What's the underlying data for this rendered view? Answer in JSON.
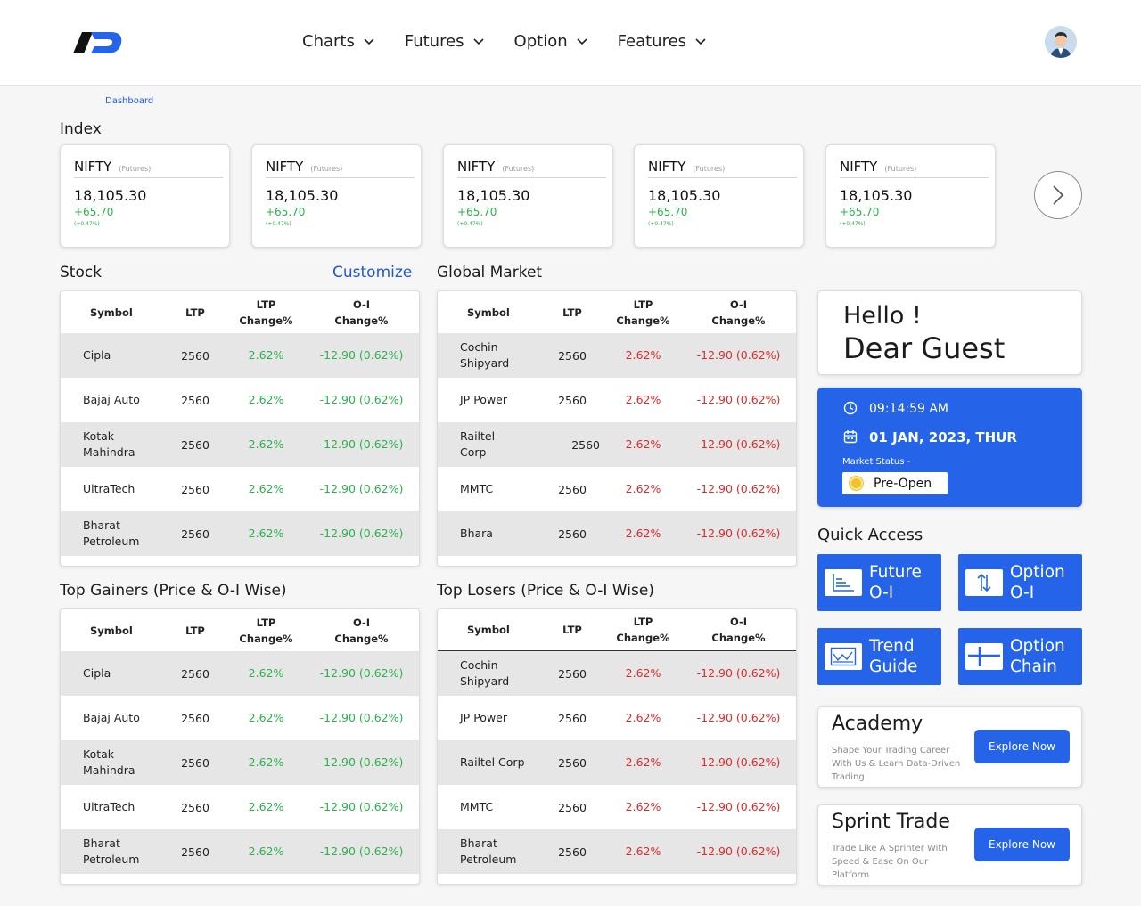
{
  "header": {
    "nav": [
      "Charts",
      "Futures",
      "Option",
      "Features"
    ]
  },
  "breadcrumb": "Dashboard",
  "index": {
    "title": "Index",
    "cards": [
      {
        "name": "NIFTY",
        "tag": "(Futures)",
        "value": "18,105.30",
        "change": "+65.70",
        "pct": "(+0.47%)"
      },
      {
        "name": "NIFTY",
        "tag": "(Futures)",
        "value": "18,105.30",
        "change": "+65.70",
        "pct": "(+0.47%)"
      },
      {
        "name": "NIFTY",
        "tag": "(Futures)",
        "value": "18,105.30",
        "change": "+65.70",
        "pct": "(+0.47%)"
      },
      {
        "name": "NIFTY",
        "tag": "(Futures)",
        "value": "18,105.30",
        "change": "+65.70",
        "pct": "(+0.47%)"
      },
      {
        "name": "NIFTY",
        "tag": "(Futures)",
        "value": "18,105.30",
        "change": "+65.70",
        "pct": "(+0.47%)"
      }
    ]
  },
  "stock": {
    "title": "Stock",
    "customize": "Customize",
    "headers": [
      "Symbol",
      "LTP",
      "LTP\nChange%",
      "O-I\nChange%"
    ],
    "rows": [
      {
        "symbol": "Cipla",
        "ltp": "2560",
        "chg": "2.62%",
        "oi": "-12.90 (0.62%)"
      },
      {
        "symbol": "Bajaj Auto",
        "ltp": "2560",
        "chg": "2.62%",
        "oi": "-12.90 (0.62%)"
      },
      {
        "symbol": "Kotak\nMahindra",
        "ltp": "2560",
        "chg": "2.62%",
        "oi": "-12.90 (0.62%)"
      },
      {
        "symbol": "UltraTech",
        "ltp": "2560",
        "chg": "2.62%",
        "oi": "-12.90 (0.62%)"
      },
      {
        "symbol": "Bharat\nPetroleum",
        "ltp": "2560",
        "chg": "2.62%",
        "oi": "-12.90 (0.62%)"
      }
    ]
  },
  "global": {
    "title": "Global Market",
    "headers": [
      "Symbol",
      "LTP",
      "LTP\nChange%",
      "O-I\nChange%"
    ],
    "rows": [
      {
        "symbol": "Cochin\nShipyard",
        "ltp": "2560",
        "chg": "2.62%",
        "oi": "-12.90 (0.62%)"
      },
      {
        "symbol": "JP Power",
        "ltp": "2560",
        "chg": "2.62%",
        "oi": "-12.90 (0.62%)"
      },
      {
        "symbol": "Railtel Corp",
        "ltp": "2560",
        "chg": "2.62%",
        "oi": "-12.90 (0.62%)"
      },
      {
        "symbol": "MMTC",
        "ltp": "2560",
        "chg": "2.62%",
        "oi": "-12.90 (0.62%)"
      },
      {
        "symbol": "Bhara",
        "ltp": "2560",
        "chg": "2.62%",
        "oi": "-12.90 (0.62%)"
      }
    ]
  },
  "gainers": {
    "title": "Top Gainers (Price & O-I Wise)",
    "headers": [
      "Symbol",
      "LTP",
      "LTP\nChange%",
      "O-I\nChange%"
    ],
    "rows": [
      {
        "symbol": "Cipla",
        "ltp": "2560",
        "chg": "2.62%",
        "oi": "-12.90 (0.62%)"
      },
      {
        "symbol": "Bajaj Auto",
        "ltp": "2560",
        "chg": "2.62%",
        "oi": "-12.90 (0.62%)"
      },
      {
        "symbol": "Kotak\nMahindra",
        "ltp": "2560",
        "chg": "2.62%",
        "oi": "-12.90 (0.62%)"
      },
      {
        "symbol": "UltraTech",
        "ltp": "2560",
        "chg": "2.62%",
        "oi": "-12.90 (0.62%)"
      },
      {
        "symbol": "Bharat\nPetroleum",
        "ltp": "2560",
        "chg": "2.62%",
        "oi": "-12.90 (0.62%)"
      }
    ]
  },
  "losers": {
    "title": "Top Losers (Price & O-I Wise)",
    "headers": [
      "Symbol",
      "LTP",
      "LTP\nChange%",
      "O-I\nChange%"
    ],
    "rows": [
      {
        "symbol": "Cochin\nShipyard",
        "ltp": "2560",
        "chg": "2.62%",
        "oi": "-12.90 (0.62%)"
      },
      {
        "symbol": "JP Power",
        "ltp": "2560",
        "chg": "2.62%",
        "oi": "-12.90 (0.62%)"
      },
      {
        "symbol": "Railtel Corp",
        "ltp": "2560",
        "chg": "2.62%",
        "oi": "-12.90 (0.62%)"
      },
      {
        "symbol": "MMTC",
        "ltp": "2560",
        "chg": "2.62%",
        "oi": "-12.90 (0.62%)"
      },
      {
        "symbol": "Bharat\nPetroleum",
        "ltp": "2560",
        "chg": "2.62%",
        "oi": "-12.90 (0.62%)"
      }
    ]
  },
  "greeting": {
    "line1": "Hello !",
    "line2": "Dear Guest"
  },
  "clock": {
    "time": "09:14:59 AM",
    "date": "01 JAN, 2023, THUR",
    "status_label": "Market Status -",
    "status": "Pre-Open"
  },
  "quick_access": {
    "title": "Quick Access",
    "items": [
      {
        "label": "Future\nO-I",
        "icon": "bar-chart-icon"
      },
      {
        "label": "Option\nO-I",
        "icon": "up-down-arrows-icon"
      },
      {
        "label": "Trend\nGuide",
        "icon": "line-chart-icon"
      },
      {
        "label": "Option\nChain",
        "icon": "crosshair-icon"
      }
    ]
  },
  "academy": {
    "title": "Academy",
    "desc": "Shape Your Trading Career With Us & Learn Data-Driven Trading",
    "button": "Explore Now"
  },
  "sprint": {
    "title": "Sprint Trade",
    "desc": "Trade Like A Sprinter With Speed & Ease On Our Platform",
    "button": "Explore Now"
  },
  "colors": {
    "accent": "#2564e8",
    "positive": "#2bb24c",
    "negative": "#e02a2a",
    "link": "#2157d9"
  }
}
